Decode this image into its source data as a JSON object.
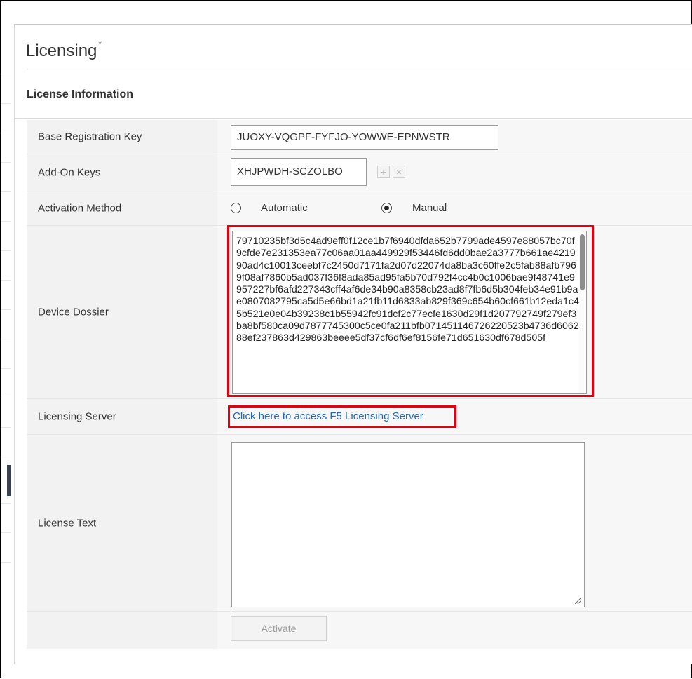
{
  "page": {
    "title": "Licensing",
    "title_marker": "*",
    "section_title": "License Information"
  },
  "form": {
    "base_key": {
      "label": "Base Registration Key",
      "value": "JUOXY-VQGPF-FYFJO-YOWWE-EPNWSTR"
    },
    "addon": {
      "label": "Add-On Keys",
      "value": "XHJPWDH-SCZOLBO",
      "add_symbol": "+",
      "remove_symbol": "×"
    },
    "activation": {
      "label": "Activation Method",
      "options": [
        {
          "label": "Automatic",
          "selected": false
        },
        {
          "label": "Manual",
          "selected": true
        }
      ]
    },
    "dossier": {
      "label": "Device Dossier",
      "value": "79710235bf3d5c4ad9eff0f12ce1b7f6940dfda652b7799ade4597e88057bc70f9cfde7e231353ea77c06aa01aa449929f53446fd6dd0bae2a3777b661ae421990ad4c10013ceebf7c2450d7171fa2d07d22074da8ba3c60ffe2c5fab88afb7969f08af7860b5ad037f36f8ada85ad95fa5b70d792f4cc4b0c1006bae9f48741e9957227bf6afd227343cff4af6de34b90a8358cb23ad8f7fb6d5b304feb34e91b9ae0807082795ca5d5e66bd1a21fb11d6833ab829f369c654b60cf661b12eda1c45b521e0e04b39238c1b55942fc91dcf2c77ecfe1630d29f1d207792749f279ef3ba8bf580ca09d7877745300c5ce0fa211bfb071451146726220523b4736d606288ef237863d429863beeee5df37cf6df6ef8156fe71d651630df678d505f"
    },
    "server": {
      "label": "Licensing Server",
      "link_text": "Click here to access F5 Licensing Server"
    },
    "license_text": {
      "label": "License Text",
      "value": ""
    },
    "activate_label": "Activate"
  },
  "colors": {
    "highlight": "#e3000f",
    "link": "#2168b5",
    "label_bg": "#f2f2f2",
    "value_bg": "#f7f7f7"
  }
}
